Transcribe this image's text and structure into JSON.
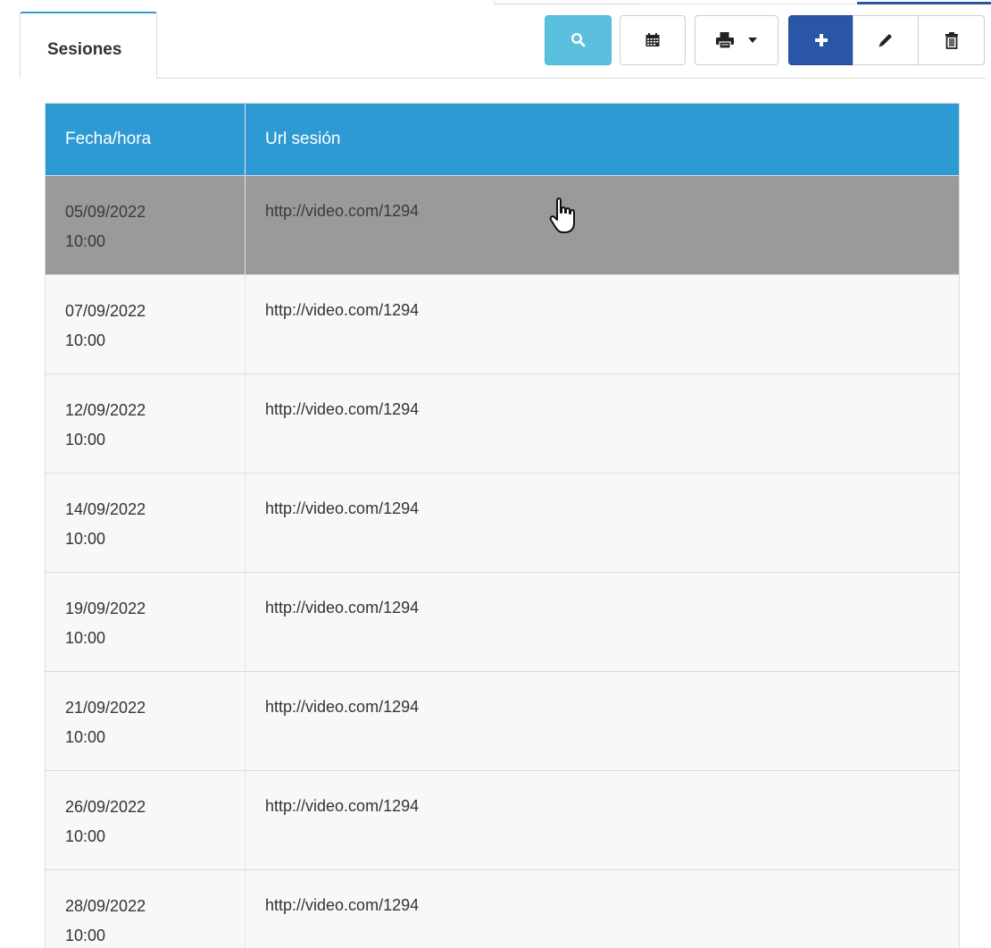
{
  "tabs": [
    {
      "label": "Sesiones"
    }
  ],
  "toolbar": {
    "search_icon": "search-icon",
    "calendar_icon": "calendar-icon",
    "print_icon": "print-icon",
    "add_icon": "plus-icon",
    "edit_icon": "pencil-icon",
    "delete_icon": "trash-icon"
  },
  "colors": {
    "header_bg": "#2e9ad4",
    "selected_row": "#9a9a9a",
    "search_button": "#5bc0de",
    "add_button": "#2a56a8"
  },
  "table": {
    "headers": [
      "Fecha/hora",
      "Url sesión"
    ],
    "rows": [
      {
        "date": "05/09/2022",
        "time": "10:00",
        "url": "http://video.com/1294",
        "selected": true
      },
      {
        "date": "07/09/2022",
        "time": "10:00",
        "url": "http://video.com/1294"
      },
      {
        "date": "12/09/2022",
        "time": "10:00",
        "url": "http://video.com/1294"
      },
      {
        "date": "14/09/2022",
        "time": "10:00",
        "url": "http://video.com/1294"
      },
      {
        "date": "19/09/2022",
        "time": "10:00",
        "url": "http://video.com/1294"
      },
      {
        "date": "21/09/2022",
        "time": "10:00",
        "url": "http://video.com/1294"
      },
      {
        "date": "26/09/2022",
        "time": "10:00",
        "url": "http://video.com/1294"
      },
      {
        "date": "28/09/2022",
        "time": "10:00",
        "url": "http://video.com/1294"
      }
    ]
  }
}
